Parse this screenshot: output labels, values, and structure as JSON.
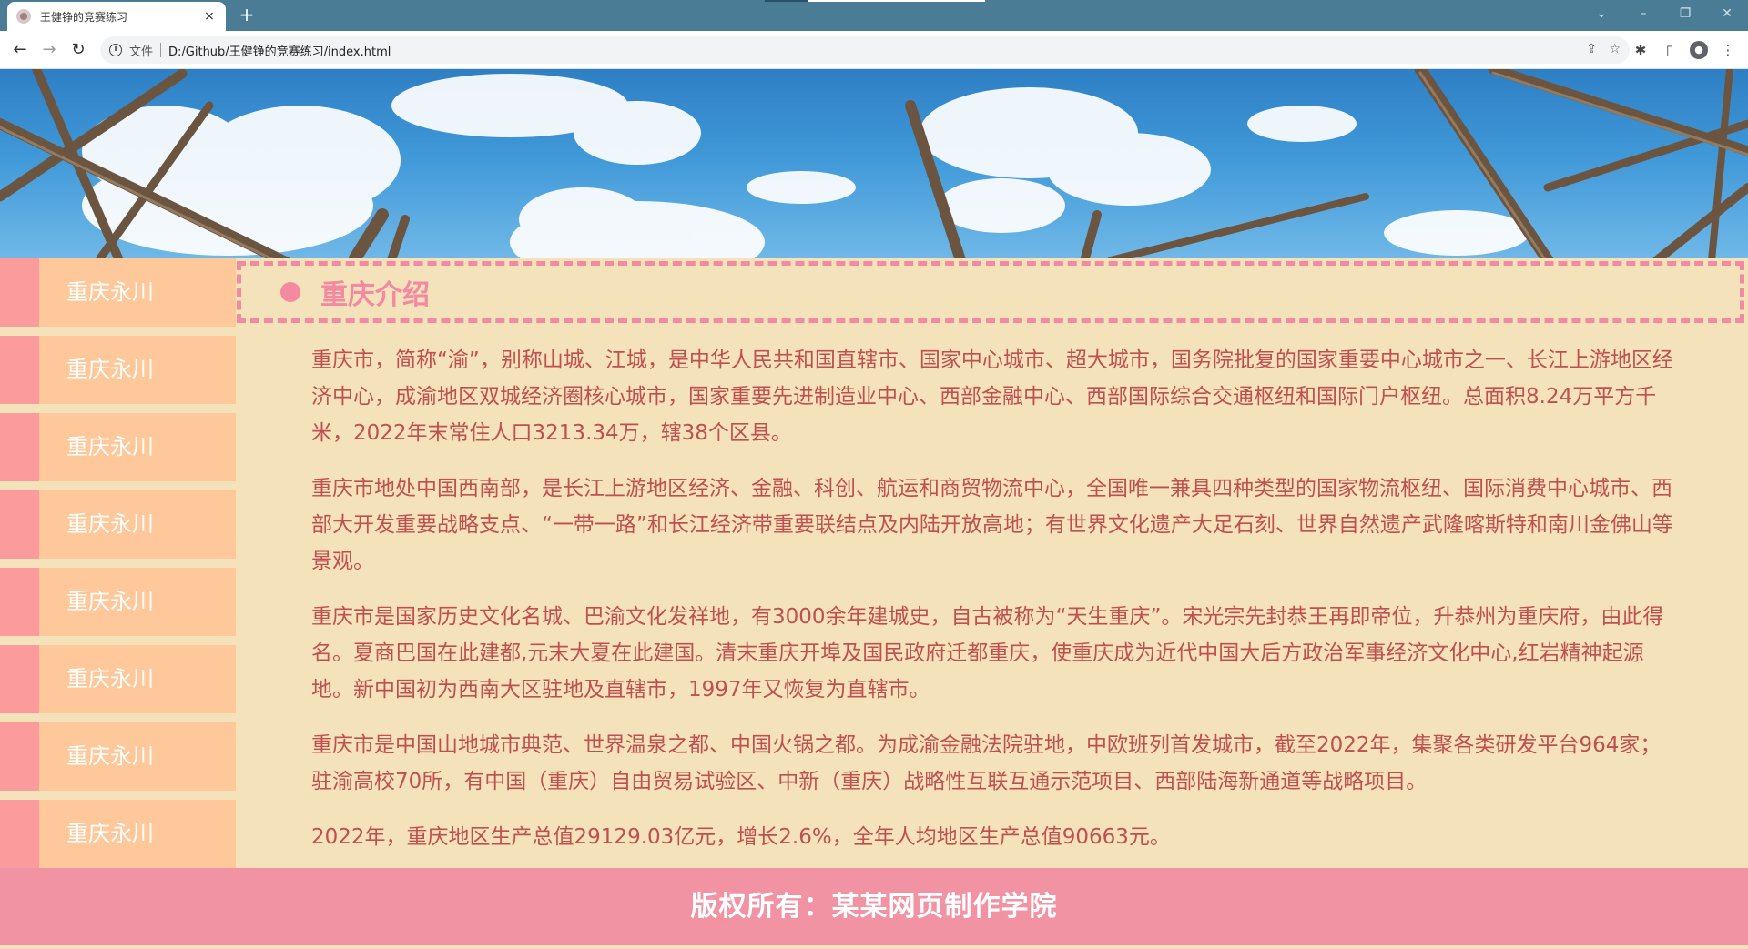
{
  "browser": {
    "tab_title": "王健铮的竞赛练习",
    "tab_close": "×",
    "new_tab": "+",
    "scheme_label": "文件",
    "url": "D:/Github/王健铮的竞赛练习/index.html",
    "info_glyph": "i"
  },
  "sidebar": {
    "items": [
      {
        "label": "重庆永川"
      },
      {
        "label": "重庆永川"
      },
      {
        "label": "重庆永川"
      },
      {
        "label": "重庆永川"
      },
      {
        "label": "重庆永川"
      },
      {
        "label": "重庆永川"
      },
      {
        "label": "重庆永川"
      },
      {
        "label": "重庆永川"
      }
    ]
  },
  "main": {
    "heading": "重庆介绍",
    "paragraphs": [
      "重庆市，简称“渝”，别称山城、江城，是中华人民共和国直辖市、国家中心城市、超大城市，国务院批复的国家重要中心城市之一、长江上游地区经济中心，成渝地区双城经济圈核心城市，国家重要先进制造业中心、西部金融中心、西部国际综合交通枢纽和国际门户枢纽。总面积8.24万平方千米，2022年末常住人口3213.34万，辖38个区县。",
      "重庆市地处中国西南部，是长江上游地区经济、金融、科创、航运和商贸物流中心，全国唯一兼具四种类型的国家物流枢纽、国际消费中心城市、西部大开发重要战略支点、“一带一路”和长江经济带重要联结点及内陆开放高地；有世界文化遗产大足石刻、世界自然遗产武隆喀斯特和南川金佛山等景观。",
      "重庆市是国家历史文化名城、巴渝文化发祥地，有3000余年建城史，自古被称为“天生重庆”。宋光宗先封恭王再即帝位，升恭州为重庆府，由此得名。夏商巴国在此建都,元末大夏在此建国。清末重庆开埠及国民政府迁都重庆，使重庆成为近代中国大后方政治军事经济文化中心,红岩精神起源地。新中国初为西南大区驻地及直辖市，1997年又恢复为直辖市。",
      "重庆市是中国山地城市典范、世界温泉之都、中国火锅之都。为成渝金融法院驻地，中欧班列首发城市，截至2022年，集聚各类研发平台964家；驻渝高校70所，有中国（重庆）自由贸易试验区、中新（重庆）战略性互联互通示范项目、西部陆海新通道等战略项目。",
      "2022年，重庆地区生产总值29129.03亿元，增长2.6%，全年人均地区生产总值90663元。"
    ]
  },
  "footer": {
    "text": "版权所有：某某网页制作学院"
  },
  "colors": {
    "page_bg": "#f4e2bb",
    "sidebar_bg": "#ffc89a",
    "sidebar_accent": "#fb9b9b",
    "heading_pink": "#f38aa1",
    "text_red": "#c0504f",
    "footer_bg": "#f293a4"
  }
}
